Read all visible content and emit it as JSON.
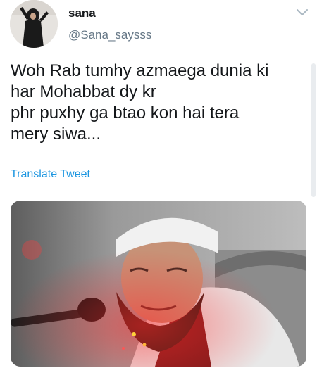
{
  "user": {
    "display_name": "sana",
    "handle": "@Sana_saysss"
  },
  "tweet": {
    "lines": [
      "Woh Rab tumhy azmaega dunia ki",
      "har Mohabbat dy kr",
      "phr puxhy ga btao kon hai tera",
      "mery siwa..."
    ],
    "translate_label": "Translate Tweet"
  },
  "icons": {
    "menu": "chevron-down-icon"
  },
  "colors": {
    "link": "#1b95e0",
    "secondary_text": "#657786",
    "primary_text": "#14171a"
  }
}
